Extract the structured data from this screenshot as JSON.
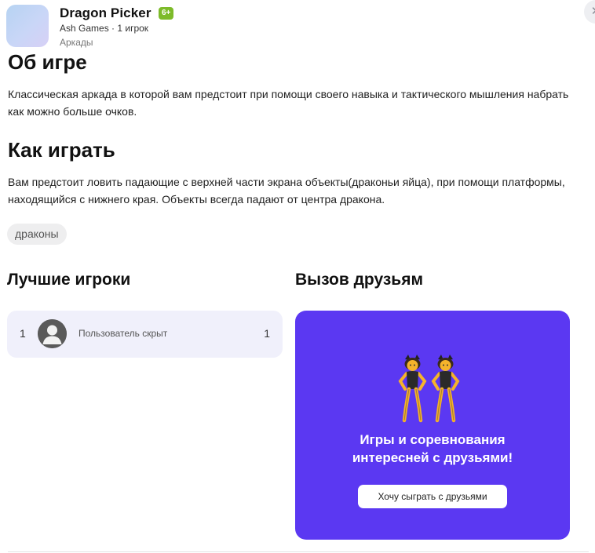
{
  "app": {
    "title": "Dragon Picker",
    "age_rating": "6+",
    "meta": "Ash Games · 1 игрок",
    "genre": "Аркады"
  },
  "about": {
    "heading": "Об игре",
    "text": "Классическая аркада в которой вам предстоит при помощи своего навыка и тактического мышления набрать как можно больше очков."
  },
  "how_to_play": {
    "heading": "Как играть",
    "text": "Вам предстоит ловить падающие с верхней части экрана объекты(драконьи яйца), при помощи платформы, находящийся с нижнего края. Объекты всегда падают от центра дракона."
  },
  "tags": [
    "драконы"
  ],
  "leaderboard": {
    "heading": "Лучшие игроки",
    "rows": [
      {
        "rank": "1",
        "name": "Пользователь скрыт",
        "score": "1"
      }
    ]
  },
  "challenge": {
    "heading": "Вызов друзьям",
    "text": "Игры и соревнования интересней с друзьями!",
    "button_label": "Хочу сыграть с друзьями",
    "background_color": "#5b38f2"
  },
  "icons": {
    "close": "close-icon",
    "avatar": "user-avatar-icon",
    "promo": "dancing-friends-icon"
  },
  "close_glyph": "✕"
}
